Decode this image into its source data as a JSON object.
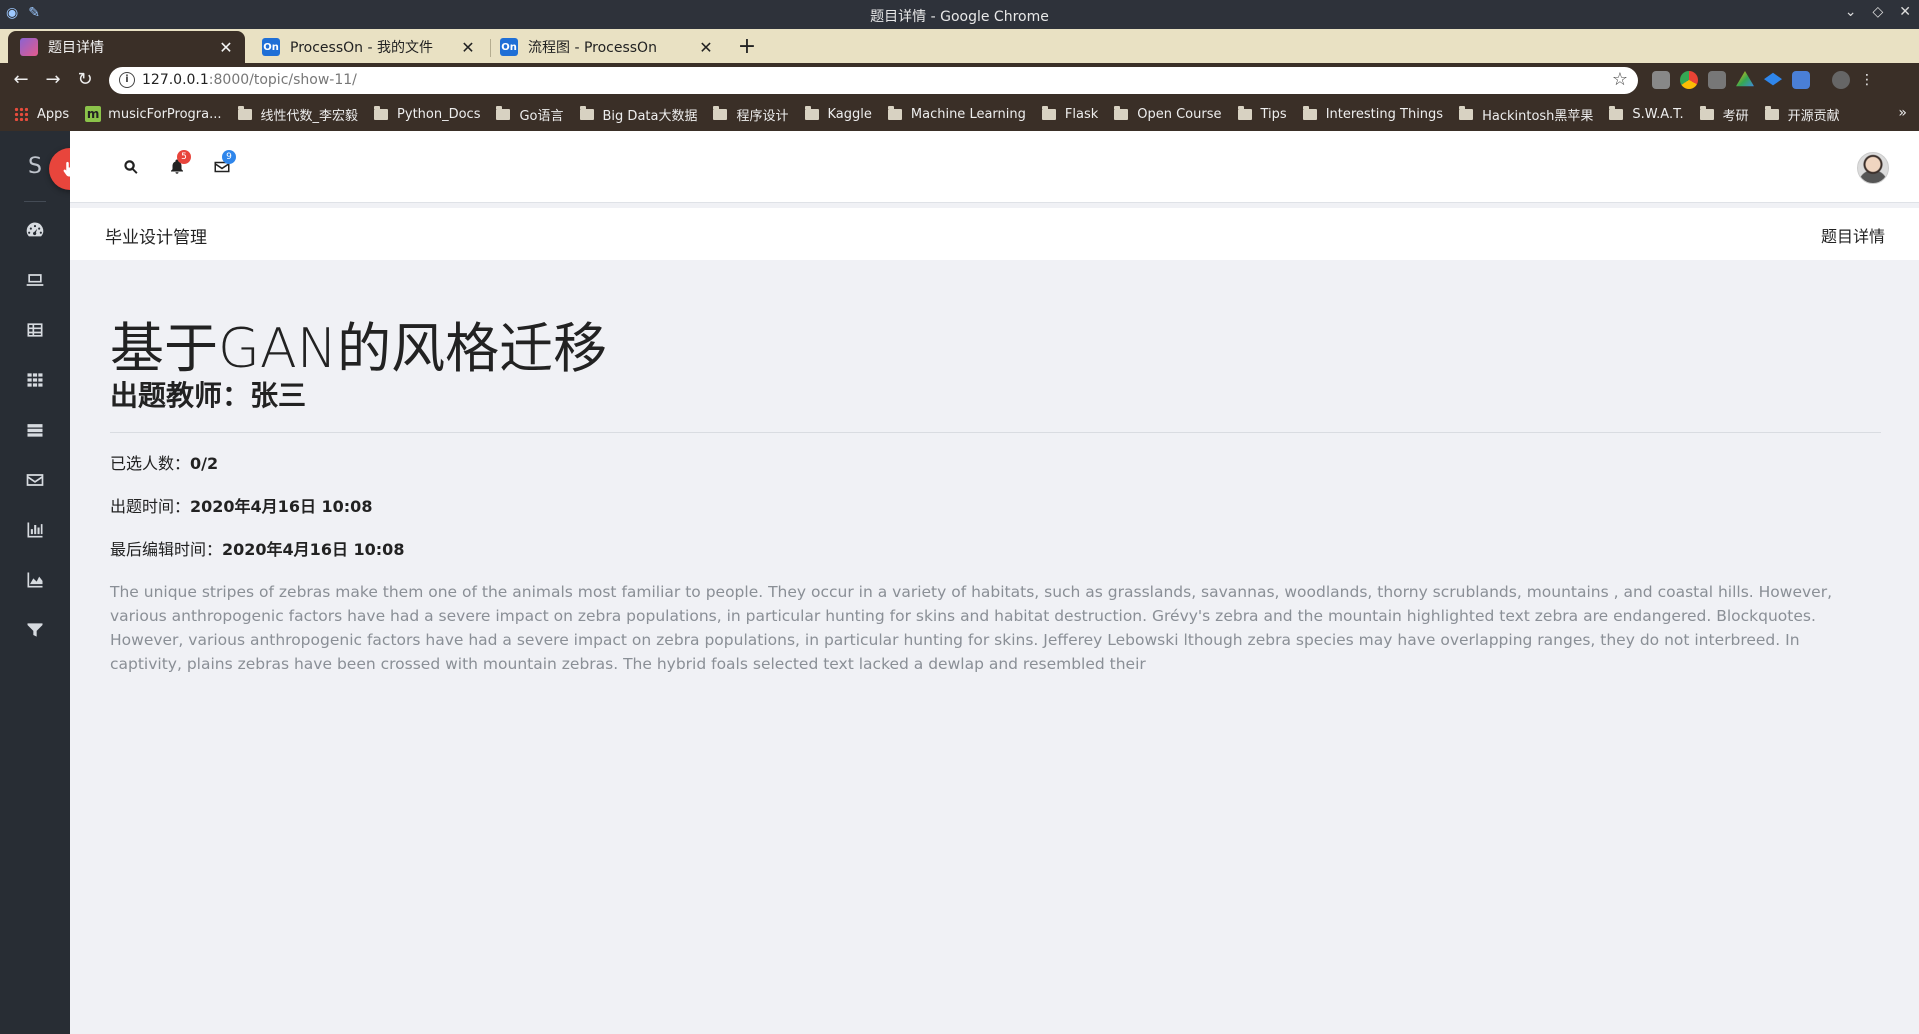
{
  "window": {
    "title": "题目详情 - Google Chrome"
  },
  "tabs": [
    {
      "label": "题目详情",
      "active": true
    },
    {
      "label": "ProcessOn - 我的文件",
      "active": false,
      "favicon_text": "On"
    },
    {
      "label": "流程图 - ProcessOn",
      "active": false,
      "favicon_text": "On"
    }
  ],
  "address_bar": {
    "url_host": "127.0.0.1",
    "url_rest": ":8000/topic/show-11/"
  },
  "bookmarks": [
    {
      "label": "Apps",
      "icon": "apps-grid-icon"
    },
    {
      "label": "musicForProgra...",
      "icon": "m-icon"
    },
    {
      "label": "线性代数_李宏毅",
      "icon": "folder-icon"
    },
    {
      "label": "Python_Docs",
      "icon": "folder-icon"
    },
    {
      "label": "Go语言",
      "icon": "folder-icon"
    },
    {
      "label": "Big Data大数据",
      "icon": "folder-icon"
    },
    {
      "label": "程序设计",
      "icon": "folder-icon"
    },
    {
      "label": "Kaggle",
      "icon": "folder-icon"
    },
    {
      "label": "Machine Learning",
      "icon": "folder-icon"
    },
    {
      "label": "Flask",
      "icon": "folder-icon"
    },
    {
      "label": "Open Course",
      "icon": "folder-icon"
    },
    {
      "label": "Tips",
      "icon": "folder-icon"
    },
    {
      "label": "Interesting Things",
      "icon": "folder-icon"
    },
    {
      "label": "Hackintosh黑苹果",
      "icon": "folder-icon"
    },
    {
      "label": "S.W.A.T.",
      "icon": "folder-icon"
    },
    {
      "label": "考研",
      "icon": "folder-icon"
    },
    {
      "label": "开源贡献",
      "icon": "folder-icon"
    }
  ],
  "sidebar": {
    "brand": "S",
    "items": [
      {
        "icon": "dashboard-icon"
      },
      {
        "icon": "laptop-icon"
      },
      {
        "icon": "table-icon"
      },
      {
        "icon": "grid-icon"
      },
      {
        "icon": "list-icon"
      },
      {
        "icon": "envelope-icon"
      },
      {
        "icon": "bar-chart-icon"
      },
      {
        "icon": "area-chart-icon"
      },
      {
        "icon": "filter-icon"
      }
    ]
  },
  "header": {
    "notifications_count": "5",
    "messages_count": "9"
  },
  "breadcrumb": {
    "left": "毕业设计管理",
    "right": "题目详情"
  },
  "topic": {
    "title": "基于GAN的风格迁移",
    "teacher": "出题教师：张三",
    "selected_label": "已选人数：",
    "selected_value": "0/2",
    "created_label": "出题时间：",
    "created_value": "2020年4月16日 10:08",
    "edited_label": "最后编辑时间：",
    "edited_value": "2020年4月16日 10:08",
    "description": "The unique stripes of zebras make them one of the animals most familiar to people. They occur in a variety of habitats, such as grasslands, savannas, woodlands, thorny scrublands, mountains , and coastal hills. However, various anthropogenic factors have had a severe impact on zebra populations, in particular hunting for skins and habitat destruction. Grévy's zebra and the mountain highlighted text zebra are endangered. Blockquotes. However, various anthropogenic factors have had a severe impact on zebra populations, in particular hunting for skins. Jefferey Lebowski lthough zebra species may have overlapping ranges, they do not interbreed. In captivity, plains zebras have been crossed with mountain zebras. The hybrid foals selected text lacked a dewlap and resembled their"
  },
  "colors": {
    "sidebar_bg": "#282d34",
    "fab_red": "#e8453c",
    "badge_blue": "#2f86eb",
    "page_bg": "#f0f1f5"
  }
}
